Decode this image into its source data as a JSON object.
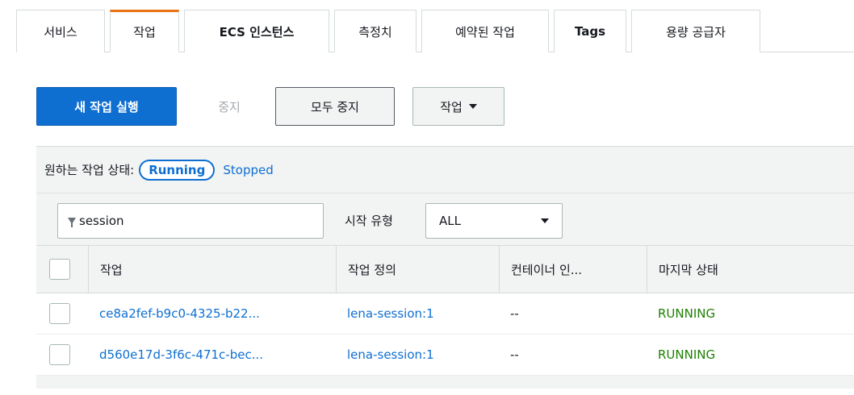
{
  "tabs": [
    {
      "label": "서비스",
      "active": false
    },
    {
      "label": "작업",
      "active": true
    },
    {
      "label": "ECS 인스턴스",
      "active": false
    },
    {
      "label": "측정치",
      "active": false
    },
    {
      "label": "예약된 작업",
      "active": false
    },
    {
      "label": "Tags",
      "active": false
    },
    {
      "label": "용량 공급자",
      "active": false
    }
  ],
  "toolbar": {
    "run_new_task": "새 작업 실행",
    "stop": "중지",
    "stop_all": "모두 중지",
    "actions": "작업"
  },
  "status_filter": {
    "label": "원하는 작업 상태:",
    "running": "Running",
    "stopped": "Stopped"
  },
  "filter": {
    "search_value": "session",
    "launch_type_label": "시작 유형",
    "launch_type_value": "ALL"
  },
  "table": {
    "columns": [
      "작업",
      "작업 정의",
      "컨테이너 인...",
      "마지막 상태"
    ],
    "rows": [
      {
        "task": "ce8a2fef-b9c0-4325-b22...",
        "task_def": "lena-session:1",
        "container": "--",
        "last_status": "RUNNING"
      },
      {
        "task": "d560e17d-3f6c-471c-bec...",
        "task_def": "lena-session:1",
        "container": "--",
        "last_status": "RUNNING"
      }
    ]
  },
  "colors": {
    "accent": "#0e6fd1",
    "tab_active": "#ec7211",
    "running": "#1d8102"
  }
}
